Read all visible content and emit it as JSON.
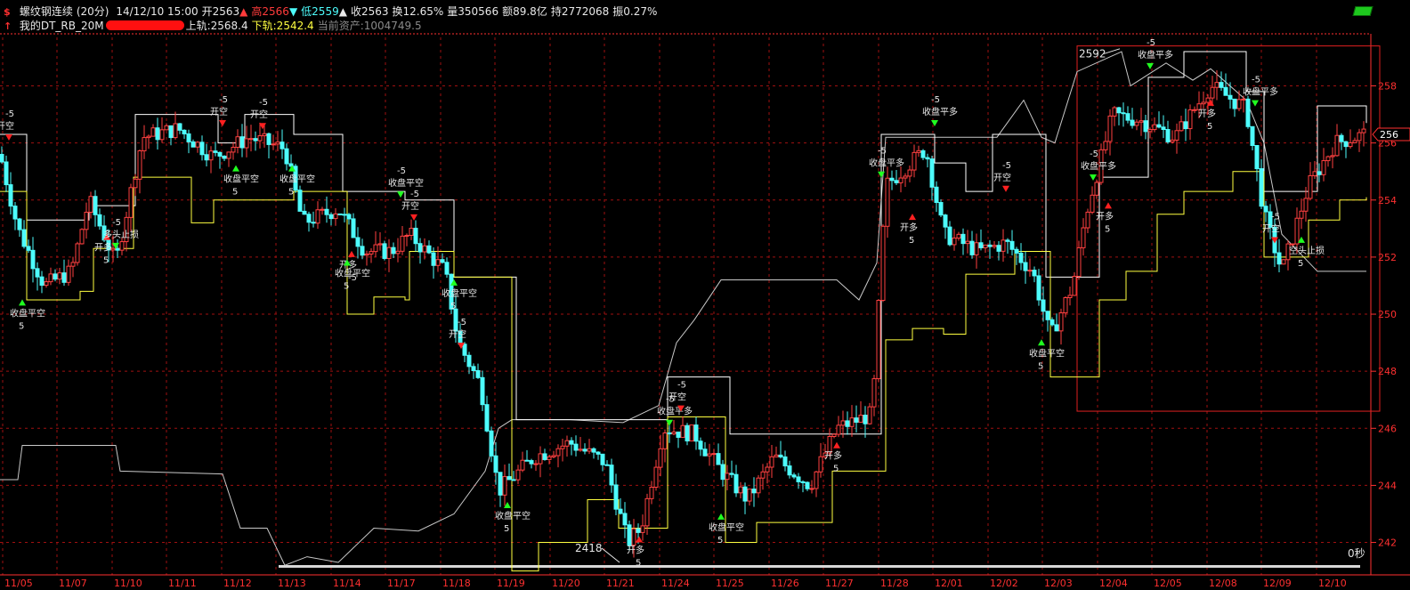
{
  "header": {
    "icon": "dollar-icon",
    "symbol": "螺纹钢连续",
    "period": "(20分)",
    "datetime": "14/12/10 15:00",
    "open_label": "开2563",
    "high_label": "高2566",
    "low_label": "低2559",
    "close_label": "收2563",
    "turnover_label": "换12.65%",
    "volume_label": "量350566",
    "amount_label": "额89.8亿",
    "open_interest_label": "持2772068",
    "amplitude_label": "振0.27%"
  },
  "indicator": {
    "icon": "up-arrow-icon",
    "name": "我的DT_RB_20M",
    "upper_label": "上轨:2568.4",
    "lower_label": "下轨:2542.4",
    "asset_label": "当前资产:1004749.5"
  },
  "status": {
    "elapsed": "0秒"
  },
  "colors": {
    "up_candle": "#ff4040",
    "down_candle": "#4dfcfc",
    "upper_band": "#ffffff",
    "lower_band": "#ffff40",
    "equity": "#c8c8c8",
    "grid": "#a01010",
    "axis": "#ff3030",
    "buy_signal": "#ff2020",
    "sell_signal": "#20ff20"
  },
  "chart_data": {
    "type": "candlestick",
    "y_tick_labels": [
      "242",
      "244",
      "246",
      "248",
      "250",
      "252",
      "254",
      "256",
      "258"
    ],
    "y_ticks": [
      2420,
      2440,
      2460,
      2480,
      2500,
      2520,
      2540,
      2560,
      2580
    ],
    "ylim": [
      2413,
      2597
    ],
    "x_tick_labels": [
      "11/05",
      "11/07",
      "11/10",
      "11/11",
      "11/12",
      "11/13",
      "11/14",
      "11/17",
      "11/18",
      "11/19",
      "11/20",
      "11/21",
      "11/24",
      "11/25",
      "11/26",
      "11/27",
      "11/28",
      "12/01",
      "12/02",
      "12/03",
      "12/04",
      "12/05",
      "12/08",
      "12/09",
      "12/10"
    ],
    "current_price_label": "256",
    "annotations": {
      "high_mark": "2592",
      "low_mark": "2418"
    },
    "key_points": [
      [
        0,
        2556
      ],
      [
        20,
        2530
      ],
      [
        50,
        2510
      ],
      [
        80,
        2515
      ],
      [
        100,
        2540
      ],
      [
        130,
        2518
      ],
      [
        160,
        2562
      ],
      [
        200,
        2565
      ],
      [
        240,
        2555
      ],
      [
        280,
        2562
      ],
      [
        320,
        2558
      ],
      [
        340,
        2532
      ],
      [
        380,
        2537
      ],
      [
        410,
        2522
      ],
      [
        440,
        2522
      ],
      [
        460,
        2528
      ],
      [
        500,
        2515
      ],
      [
        515,
        2490
      ],
      [
        540,
        2475
      ],
      [
        560,
        2438
      ],
      [
        600,
        2450
      ],
      [
        640,
        2455
      ],
      [
        680,
        2448
      ],
      [
        705,
        2420
      ],
      [
        720,
        2425
      ],
      [
        745,
        2460
      ],
      [
        780,
        2458
      ],
      [
        810,
        2445
      ],
      [
        840,
        2435
      ],
      [
        870,
        2450
      ],
      [
        910,
        2440
      ],
      [
        940,
        2460
      ],
      [
        980,
        2465
      ],
      [
        995,
        2545
      ],
      [
        1040,
        2558
      ],
      [
        1060,
        2528
      ],
      [
        1100,
        2522
      ],
      [
        1130,
        2525
      ],
      [
        1160,
        2515
      ],
      [
        1180,
        2492
      ],
      [
        1205,
        2510
      ],
      [
        1220,
        2535
      ],
      [
        1250,
        2570
      ],
      [
        1280,
        2568
      ],
      [
        1320,
        2562
      ],
      [
        1360,
        2580
      ],
      [
        1400,
        2572
      ],
      [
        1420,
        2535
      ],
      [
        1440,
        2515
      ],
      [
        1470,
        2545
      ],
      [
        1500,
        2560
      ],
      [
        1532,
        2563
      ]
    ],
    "upper_band_steps": [
      [
        0,
        2563
      ],
      [
        30,
        2533
      ],
      [
        95,
        2533
      ],
      [
        100,
        2538
      ],
      [
        120,
        2538
      ],
      [
        152,
        2570
      ],
      [
        240,
        2570
      ],
      [
        245,
        2560
      ],
      [
        275,
        2570
      ],
      [
        330,
        2563
      ],
      [
        385,
        2543
      ],
      [
        455,
        2540
      ],
      [
        510,
        2513
      ],
      [
        575,
        2513
      ],
      [
        580,
        2463
      ],
      [
        665,
        2463
      ],
      [
        700,
        2463
      ],
      [
        750,
        2478
      ],
      [
        815,
        2478
      ],
      [
        820,
        2458
      ],
      [
        990,
        2563
      ],
      [
        1050,
        2553
      ],
      [
        1085,
        2543
      ],
      [
        1115,
        2563
      ],
      [
        1175,
        2513
      ],
      [
        1235,
        2548
      ],
      [
        1270,
        2548
      ],
      [
        1290,
        2583
      ],
      [
        1330,
        2592
      ],
      [
        1400,
        2578
      ],
      [
        1420,
        2543
      ],
      [
        1480,
        2573
      ],
      [
        1535,
        2567
      ]
    ],
    "lower_band_steps": [
      [
        0,
        2543
      ],
      [
        30,
        2505
      ],
      [
        90,
        2508
      ],
      [
        105,
        2523
      ],
      [
        150,
        2548
      ],
      [
        210,
        2548
      ],
      [
        215,
        2532
      ],
      [
        240,
        2540
      ],
      [
        330,
        2543
      ],
      [
        390,
        2500
      ],
      [
        420,
        2506
      ],
      [
        455,
        2505
      ],
      [
        460,
        2522
      ],
      [
        510,
        2513
      ],
      [
        575,
        2410
      ],
      [
        605,
        2420
      ],
      [
        660,
        2435
      ],
      [
        695,
        2425
      ],
      [
        750,
        2464
      ],
      [
        815,
        2420
      ],
      [
        850,
        2427
      ],
      [
        935,
        2445
      ],
      [
        995,
        2491
      ],
      [
        1025,
        2495
      ],
      [
        1060,
        2493
      ],
      [
        1085,
        2514
      ],
      [
        1140,
        2522
      ],
      [
        1180,
        2478
      ],
      [
        1235,
        2505
      ],
      [
        1265,
        2515
      ],
      [
        1300,
        2535
      ],
      [
        1330,
        2543
      ],
      [
        1385,
        2550
      ],
      [
        1420,
        2520
      ],
      [
        1470,
        2533
      ],
      [
        1505,
        2540
      ],
      [
        1535,
        2541
      ]
    ],
    "equity_curve": [
      [
        0,
        2442
      ],
      [
        20,
        2442
      ],
      [
        25,
        2454
      ],
      [
        130,
        2454
      ],
      [
        135,
        2445
      ],
      [
        250,
        2444
      ],
      [
        270,
        2425
      ],
      [
        300,
        2425
      ],
      [
        320,
        2412
      ],
      [
        345,
        2415
      ],
      [
        380,
        2413
      ],
      [
        420,
        2425
      ],
      [
        470,
        2424
      ],
      [
        510,
        2430
      ],
      [
        545,
        2445
      ],
      [
        560,
        2460
      ],
      [
        575,
        2463
      ],
      [
        640,
        2463
      ],
      [
        700,
        2462
      ],
      [
        740,
        2468
      ],
      [
        760,
        2490
      ],
      [
        780,
        2498
      ],
      [
        810,
        2512
      ],
      [
        940,
        2512
      ],
      [
        965,
        2505
      ],
      [
        985,
        2518
      ],
      [
        995,
        2562
      ],
      [
        1120,
        2562
      ],
      [
        1150,
        2575
      ],
      [
        1170,
        2562
      ],
      [
        1185,
        2560
      ],
      [
        1210,
        2585
      ],
      [
        1260,
        2592
      ],
      [
        1270,
        2580
      ],
      [
        1310,
        2588
      ],
      [
        1340,
        2582
      ],
      [
        1360,
        2586
      ],
      [
        1400,
        2575
      ],
      [
        1420,
        2560
      ],
      [
        1440,
        2528
      ],
      [
        1480,
        2515
      ],
      [
        1535,
        2515
      ]
    ],
    "highlight_range": {
      "x_start": 1210,
      "x_end": 1550,
      "y_low": 2466,
      "y_high": 2594
    },
    "signals": [
      {
        "x": 10,
        "text": "开空",
        "qty": "-5",
        "dir": "short",
        "price": 2558
      },
      {
        "x": 25,
        "text": "收盘平空",
        "qty": "5",
        "dir": "cover",
        "price": 2508
      },
      {
        "x": 120,
        "text": "开多",
        "qty": "5",
        "dir": "long",
        "price": 2531
      },
      {
        "x": 130,
        "text": "多头止损",
        "qty": "-5",
        "dir": "sell",
        "price": 2520
      },
      {
        "x": 250,
        "text": "开空",
        "qty": "-5",
        "dir": "short",
        "price": 2563
      },
      {
        "x": 265,
        "text": "收盘平空",
        "qty": "5",
        "dir": "cover",
        "price": 2555
      },
      {
        "x": 295,
        "text": "开空",
        "qty": "-5",
        "dir": "short",
        "price": 2562
      },
      {
        "x": 328,
        "text": "收盘平空",
        "qty": "5",
        "dir": "cover",
        "price": 2555
      },
      {
        "x": 395,
        "text": "开多",
        "qty": "-5",
        "dir": "long",
        "price": 2525
      },
      {
        "x": 390,
        "text": "收盘平空",
        "qty": "5",
        "dir": "cover",
        "price": 2522
      },
      {
        "x": 450,
        "text": "收盘平空",
        "qty": "-5",
        "dir": "sell",
        "price": 2538
      },
      {
        "x": 465,
        "text": "开空",
        "qty": "-5",
        "dir": "short",
        "price": 2530
      },
      {
        "x": 510,
        "text": "收盘平空",
        "qty": "5",
        "dir": "cover",
        "price": 2515
      },
      {
        "x": 518,
        "text": "开空",
        "qty": "-5",
        "dir": "short",
        "price": 2485
      },
      {
        "x": 570,
        "text": "收盘平空",
        "qty": "5",
        "dir": "cover",
        "price": 2437
      },
      {
        "x": 718,
        "text": "开多",
        "qty": "5",
        "dir": "long",
        "price": 2425
      },
      {
        "x": 752,
        "text": "收盘平多",
        "qty": "-5",
        "dir": "sell",
        "price": 2458
      },
      {
        "x": 765,
        "text": "开空",
        "qty": "-5",
        "dir": "short",
        "price": 2463
      },
      {
        "x": 810,
        "text": "收盘平空",
        "qty": "5",
        "dir": "cover",
        "price": 2433
      },
      {
        "x": 940,
        "text": "开多",
        "qty": "5",
        "dir": "long",
        "price": 2458
      },
      {
        "x": 990,
        "text": "收盘平多",
        "qty": "-5",
        "dir": "sell",
        "price": 2545
      },
      {
        "x": 1025,
        "text": "开多",
        "qty": "5",
        "dir": "long",
        "price": 2538
      },
      {
        "x": 1050,
        "text": "收盘平多",
        "qty": "-5",
        "dir": "sell",
        "price": 2563
      },
      {
        "x": 1130,
        "text": "开空",
        "qty": "-5",
        "dir": "short",
        "price": 2540
      },
      {
        "x": 1170,
        "text": "收盘平空",
        "qty": "5",
        "dir": "cover",
        "price": 2494
      },
      {
        "x": 1228,
        "text": "收盘平多",
        "qty": "-5",
        "dir": "sell",
        "price": 2544
      },
      {
        "x": 1245,
        "text": "开多",
        "qty": "5",
        "dir": "long",
        "price": 2542
      },
      {
        "x": 1292,
        "text": "收盘平多",
        "qty": "-5",
        "dir": "sell",
        "price": 2583
      },
      {
        "x": 1360,
        "text": "开多",
        "qty": "5",
        "dir": "long",
        "price": 2578
      },
      {
        "x": 1410,
        "text": "收盘平多",
        "qty": "-5",
        "dir": "sell",
        "price": 2570
      },
      {
        "x": 1432,
        "text": "开空",
        "qty": "-5",
        "dir": "short",
        "price": 2522
      },
      {
        "x": 1462,
        "text": "空头止损",
        "qty": "5",
        "dir": "cover",
        "price": 2530
      }
    ]
  }
}
